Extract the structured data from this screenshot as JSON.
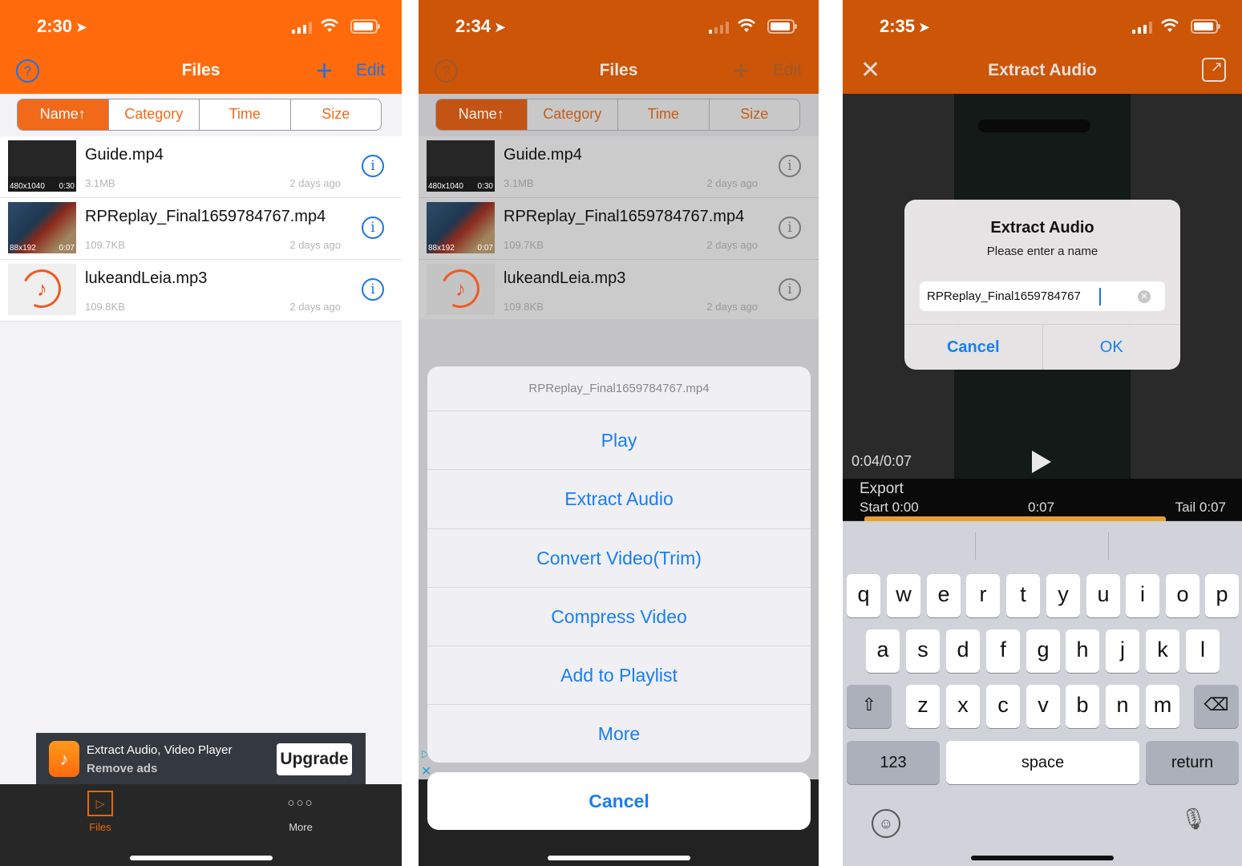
{
  "colors": {
    "brand_orange": "#ff6a0c",
    "ios_blue": "#1a7ef2",
    "tabbar_dark": "#272727"
  },
  "panel1": {
    "status": {
      "time": "2:30"
    },
    "nav": {
      "title": "Files",
      "help_icon": "?",
      "add_icon": "+",
      "edit_label": "Edit"
    },
    "sort_tabs": [
      "Name↑",
      "Category",
      "Time",
      "Size"
    ],
    "files": [
      {
        "name": "Guide.mp4",
        "size": "3.1MB",
        "date": "2 days ago",
        "resolution": "480x1040",
        "duration": "0:30",
        "kind": "video"
      },
      {
        "name": "RPReplay_Final1659784767.mp4",
        "size": "109.7KB",
        "date": "2 days ago",
        "resolution": "88x192",
        "duration": "0:07",
        "kind": "video"
      },
      {
        "name": "lukeandLeia.mp3",
        "size": "109.8KB",
        "date": "2 days ago",
        "kind": "audio"
      }
    ],
    "ad": {
      "title": "Extract Audio, Video Player",
      "subtitle": "Remove ads",
      "button": "Upgrade"
    },
    "tabbar": [
      {
        "label": "Files",
        "active": true
      },
      {
        "label": "More",
        "active": false
      }
    ]
  },
  "panel2": {
    "status": {
      "time": "2:34"
    },
    "nav": {
      "title": "Files",
      "help_icon": "?",
      "add_icon": "+",
      "edit_label": "Edit"
    },
    "sort_tabs": [
      "Name↑",
      "Category",
      "Time",
      "Size"
    ],
    "files": [
      {
        "name": "Guide.mp4",
        "size": "3.1MB",
        "date": "2 days ago",
        "resolution": "480x1040",
        "duration": "0:30"
      },
      {
        "name": "RPReplay_Final1659784767.mp4",
        "size": "109.7KB",
        "date": "2 days ago",
        "resolution": "88x192",
        "duration": "0:07"
      },
      {
        "name": "lukeandLeia.mp3",
        "size": "109.8KB",
        "date": "2 days ago"
      }
    ],
    "action_sheet": {
      "title": "RPReplay_Final1659784767.mp4",
      "items": [
        "Play",
        "Extract Audio",
        "Convert Video(Trim)",
        "Compress Video",
        "Add to Playlist",
        "More"
      ],
      "cancel": "Cancel"
    }
  },
  "panel3": {
    "status": {
      "time": "2:35"
    },
    "nav": {
      "title": "Extract Audio"
    },
    "player": {
      "position": "0:04/0:07",
      "export_label": "Export",
      "start": "Start 0:00",
      "length": "0:07",
      "tail": "Tail 0:07"
    },
    "alert": {
      "title": "Extract Audio",
      "message": "Please enter a name",
      "input_value": "RPReplay_Final1659784767",
      "cancel": "Cancel",
      "ok": "OK"
    },
    "keyboard": {
      "row1": [
        "q",
        "w",
        "e",
        "r",
        "t",
        "y",
        "u",
        "i",
        "o",
        "p"
      ],
      "row2": [
        "a",
        "s",
        "d",
        "f",
        "g",
        "h",
        "j",
        "k",
        "l"
      ],
      "row3": [
        "z",
        "x",
        "c",
        "v",
        "b",
        "n",
        "m"
      ],
      "numbers": "123",
      "space": "space",
      "return": "return"
    }
  }
}
